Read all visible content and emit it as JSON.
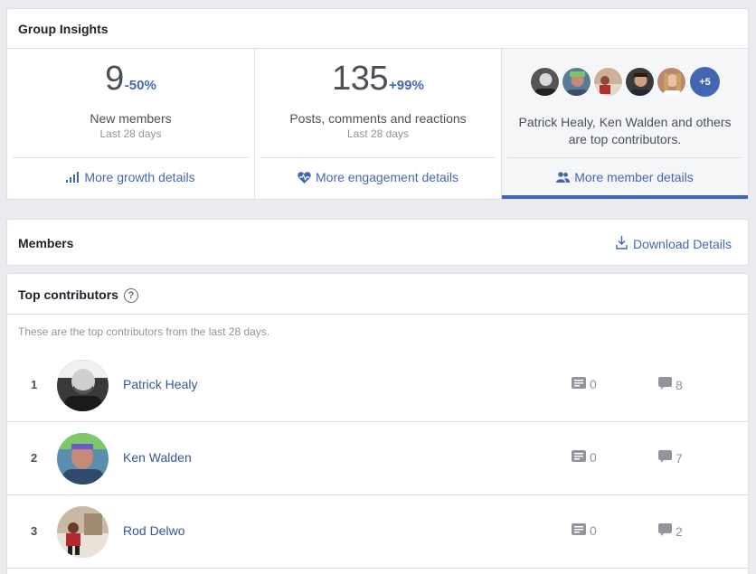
{
  "insights": {
    "title": "Group Insights",
    "growth": {
      "value": "9",
      "delta": "-50%",
      "label": "New members",
      "period": "Last 28 days",
      "link": "More growth details",
      "icon": "bar-chart-icon"
    },
    "engagement": {
      "value": "135",
      "delta": "+99%",
      "label": "Posts, comments and reactions",
      "period": "Last 28 days",
      "link": "More engagement details",
      "icon": "heart-pulse-icon"
    },
    "members": {
      "extra_count": "+5",
      "text": "Patrick Healy, Ken Walden and others are top contributors.",
      "link": "More member details",
      "icon": "people-icon"
    }
  },
  "members_section": {
    "title": "Members",
    "download_label": "Download Details"
  },
  "top_contributors": {
    "title": "Top contributors",
    "help": "?",
    "description": "These are the top contributors from the last 28 days.",
    "rows": [
      {
        "rank": "1",
        "name": "Patrick Healy",
        "posts": "0",
        "comments": "8"
      },
      {
        "rank": "2",
        "name": "Ken Walden",
        "posts": "0",
        "comments": "7"
      },
      {
        "rank": "3",
        "name": "Rod Delwo",
        "posts": "0",
        "comments": "2"
      }
    ]
  },
  "colors": {
    "accent": "#4267b2",
    "link": "#365899",
    "muted": "#90949c",
    "background": "#e9ebee"
  }
}
